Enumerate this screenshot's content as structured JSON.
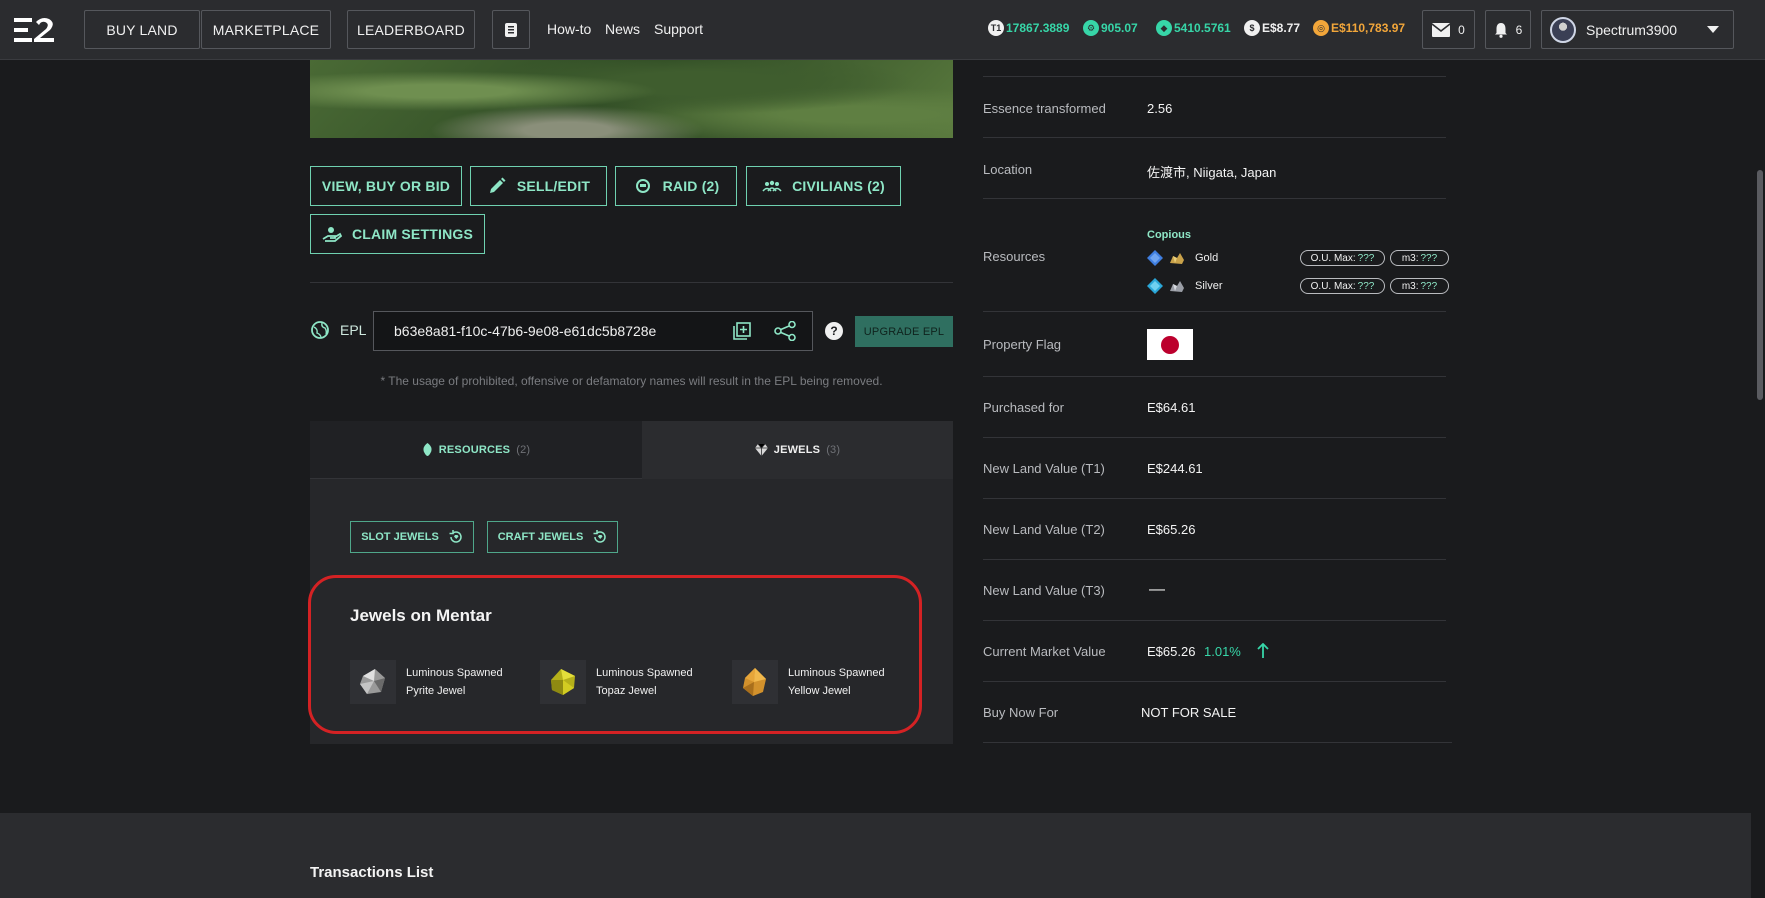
{
  "nav": {
    "buy_land": "BUY LAND",
    "marketplace": "MARKETPLACE",
    "leaderboard": "LEADERBOARD",
    "links": [
      "How-to",
      "News",
      "Support"
    ],
    "currencies": [
      {
        "icon": "t1-token-icon",
        "value": "17867.3889",
        "color": "#37d6a8"
      },
      {
        "icon": "essence-icon",
        "value": "905.07",
        "color": "#37d6a8"
      },
      {
        "icon": "ether-icon",
        "value": "5410.5761",
        "color": "#37d6a8"
      },
      {
        "icon": "dollar-icon",
        "value": "E$8.77",
        "color": "#f0f0f0"
      },
      {
        "icon": "gold-coin-icon",
        "value": "E$110,783.97",
        "color": "#f2a63a"
      }
    ],
    "messages": "0",
    "notifications": "6",
    "username": "Spectrum3900"
  },
  "actions": {
    "view_buy_bid": "VIEW, BUY OR BID",
    "sell_edit": "SELL/EDIT",
    "raid": "RAID (2)",
    "civilians": "CIVILIANS (2)",
    "claim_settings": "CLAIM SETTINGS"
  },
  "epl": {
    "label": "EPL",
    "value": "b63e8a81-f10c-47b6-9e08-e61dc5b8728e",
    "help": "?",
    "upgrade": "UPGRADE EPL",
    "disclaimer": "* The usage of prohibited, offensive or defamatory names will result in the EPL being removed."
  },
  "tabs": {
    "resources": "RESOURCES",
    "resources_count": "(2)",
    "jewels": "JEWELS",
    "jewels_count": "(3)"
  },
  "jewels_panel": {
    "slot": "SLOT JEWELS",
    "craft": "CRAFT JEWELS",
    "title": "Jewels on Mentar",
    "items": [
      {
        "line1": "Luminous Spawned",
        "line2": "Pyrite Jewel",
        "color": "#b8b8b8"
      },
      {
        "line1": "Luminous Spawned",
        "line2": "Topaz Jewel",
        "color": "#c9c21c"
      },
      {
        "line1": "Luminous Spawned",
        "line2": "Yellow Jewel",
        "color": "#e0a23a"
      }
    ]
  },
  "details": {
    "essence_label": "Essence transformed",
    "essence_value": "2.56",
    "location_label": "Location",
    "location_value": "佐渡市, Niigata, Japan",
    "resources_label": "Resources",
    "resources_tier": "Copious",
    "resources": [
      {
        "name": "Gold",
        "ou_label": "O.U. Max:",
        "ou": "???",
        "m3_label": "m3:",
        "m3": "???"
      },
      {
        "name": "Silver",
        "ou_label": "O.U. Max:",
        "ou": "???",
        "m3_label": "m3:",
        "m3": "???"
      }
    ],
    "flag_label": "Property Flag",
    "purchased_label": "Purchased for",
    "purchased_value": "E$64.61",
    "t1_label": "New Land Value (T1)",
    "t1_value": "E$244.61",
    "t2_label": "New Land Value (T2)",
    "t2_value": "E$65.26",
    "t3_label": "New Land Value (T3)",
    "t3_value": "—",
    "cmv_label": "Current Market Value",
    "cmv_value": "E$65.26",
    "cmv_change": "1.01%",
    "buy_now_label": "Buy Now For",
    "buy_now_value": "NOT FOR SALE"
  },
  "footer": {
    "title": "Transactions List"
  }
}
